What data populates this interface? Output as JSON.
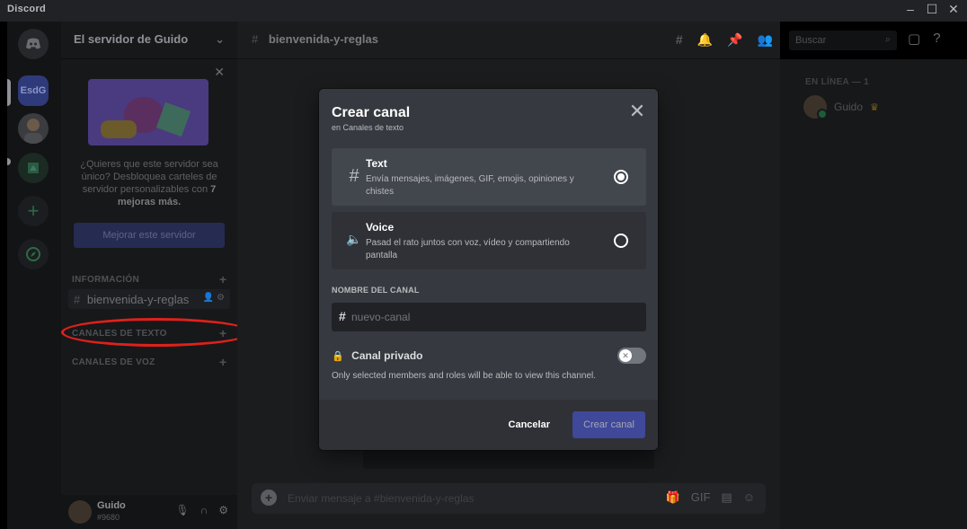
{
  "window": {
    "app_name": "Discord",
    "minimize": "–",
    "maximize": "☐",
    "close": "✕"
  },
  "server_rail": {
    "server_initials": "EsdG",
    "add_label": "+",
    "explore_label": "◉"
  },
  "sidebar": {
    "server_name": "El servidor de Guido",
    "boost_text_1": "¿Quieres que este servidor sea único? Desbloquea carteles de servidor personalizables con",
    "boost_count": "7",
    "boost_text_2": "mejoras más.",
    "boost_button": "Mejorar este servidor",
    "categories": [
      {
        "label": "INFORMACIÓN"
      },
      {
        "label": "CANALES DE TEXTO"
      },
      {
        "label": "CANALES DE VOZ"
      }
    ],
    "channel": "bienvenida-y-reglas",
    "user": {
      "name": "Guido",
      "tag": "#9680"
    }
  },
  "main": {
    "channel_name": "bienvenida-y-reglas",
    "composer_placeholder": "Enviar mensaje a #bienvenida-y-reglas"
  },
  "search": {
    "placeholder": "Buscar"
  },
  "members": {
    "heading": "EN LÍNEA — 1",
    "member_name": "Guido"
  },
  "modal": {
    "title": "Crear canal",
    "subtitle": "en Canales de texto",
    "options": [
      {
        "label": "Text",
        "description": "Envía mensajes, imágenes, GIF, emojis, opiniones y chistes",
        "icon": "hash-icon",
        "selected": true
      },
      {
        "label": "Voice",
        "description": "Pasad el rato juntos con voz, vídeo y compartiendo pantalla",
        "icon": "speaker-icon",
        "selected": false
      }
    ],
    "field_label": "NOMBRE DEL CANAL",
    "channel_placeholder": "nuevo-canal",
    "private_label": "Canal privado",
    "private_desc": "Only selected members and roles will be able to view this channel.",
    "cancel_label": "Cancelar",
    "create_label": "Crear canal"
  },
  "colors": {
    "accent": "#5865f2",
    "annotation": "#e0201b"
  }
}
